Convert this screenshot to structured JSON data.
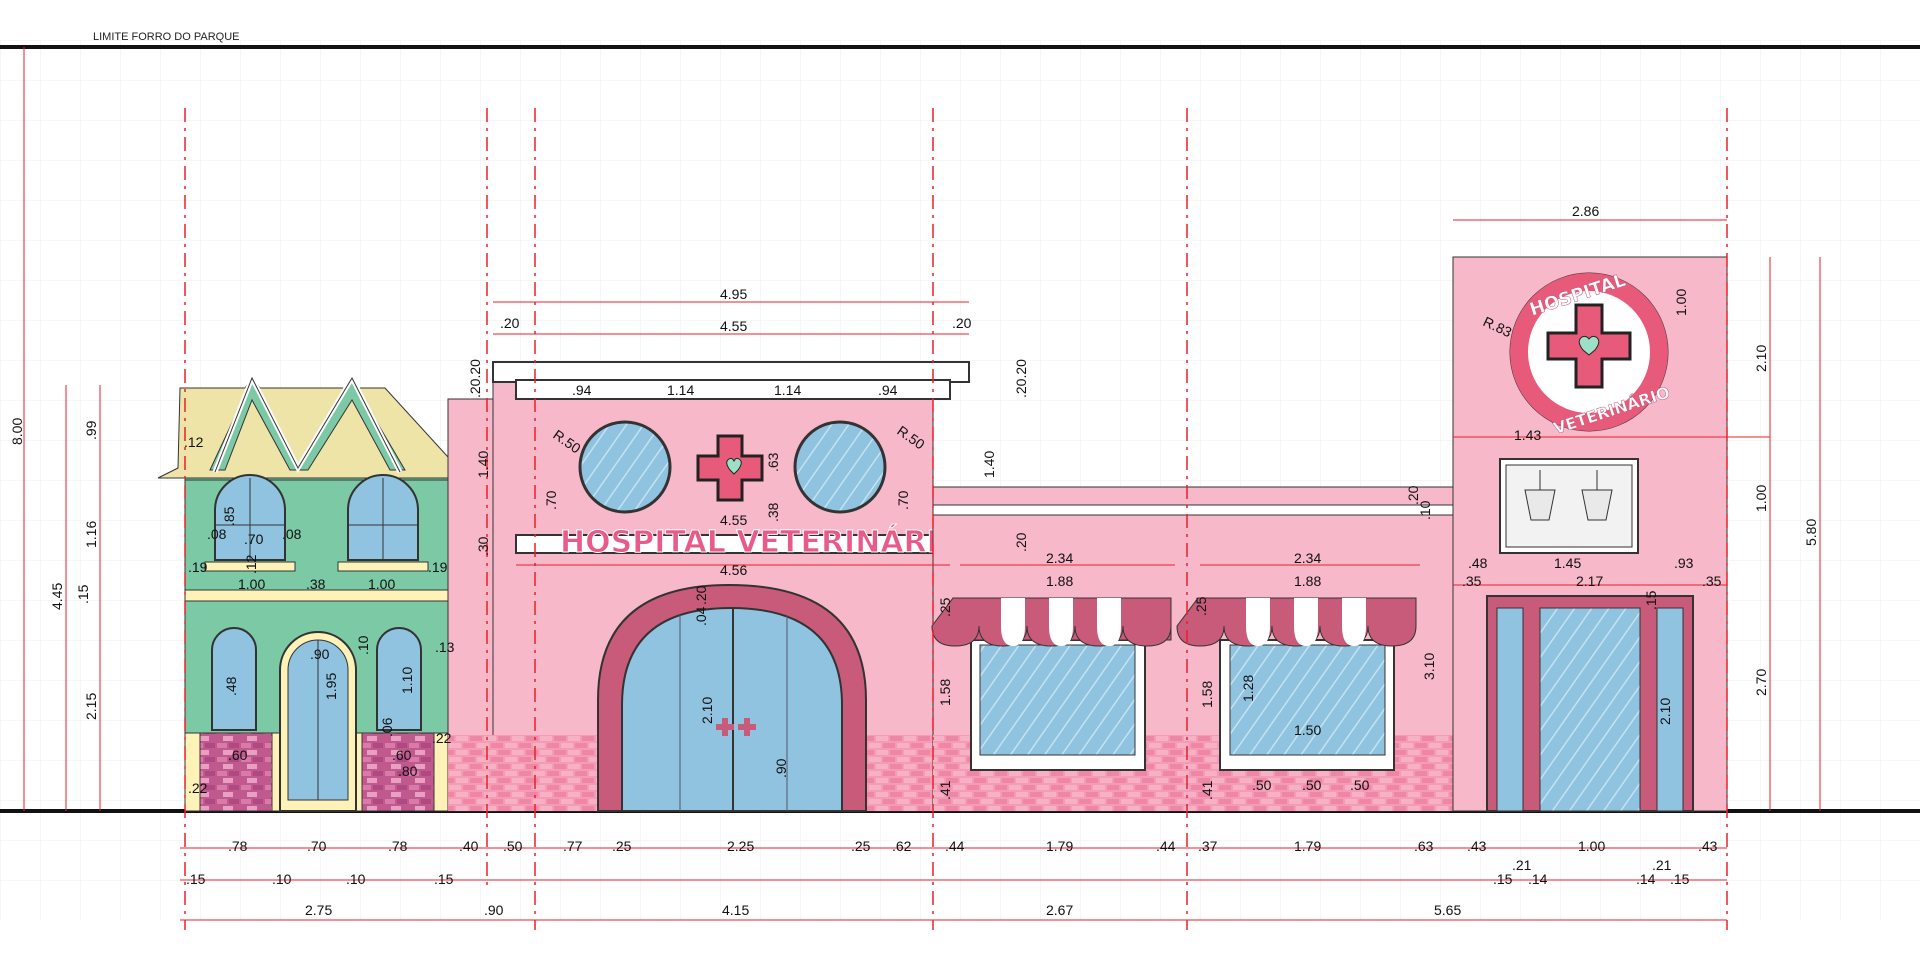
{
  "drawing": {
    "ceiling_label": "LIMITE FORRO DO PARQUE",
    "sign_text": "HOSPITAL VETERINÁRIO",
    "badge_top": "HOSPITAL",
    "badge_bottom": "VETERINÁRIO",
    "colors": {
      "dimension": "#e8202a",
      "pink_wall": "#f7b8c9",
      "dark_pink": "#c85a7a",
      "green_house": "#7cc9a6",
      "roof": "#efe4a8",
      "glass": "#8fc3e0",
      "brick": "#f08aa8"
    }
  },
  "dimensions": {
    "total_height": "8.00",
    "house_height": "4.45",
    "house_roof": ".99",
    "house_upper": "1.16",
    "house_band": ".15",
    "house_lower": "2.15",
    "eave": ".12",
    "house_w1": ".19",
    "house_w2": "1.00",
    "house_w3": ".38",
    "house_w4": "1.00",
    "house_w5": ".19",
    "upper_win_w": ".70",
    "upper_win_side_l": ".08",
    "upper_win_side_r": ".08",
    "upper_win_arch": ".85",
    "upper_win_sill": ".12",
    "door_w": ".90",
    "door_h": "1.95",
    "door_top": ".10",
    "small_win_h": ".48",
    "small_win_h2": "1.10",
    "small_win_top": ".06",
    "small_win_side": ".13",
    "planter_w1": ".60",
    "planter_w2": ".60",
    "planter_h": ".80",
    "planter_gap": ".22",
    "base_l": ".22",
    "hospital_top": "4.95",
    "hospital_inner": "4.55",
    "cornice_l": ".20",
    "cornice_r": ".20",
    "cornice_h_l": ".20.20",
    "cornice_h_r": ".20.20",
    "porthole_r_l": "R.50",
    "porthole_r_r": "R.50",
    "porthole_h_l": ".70",
    "porthole_h_r": ".70",
    "wall_upper_l": "1.40",
    "wall_upper_r": "1.40",
    "cross_h": ".63",
    "cross_sub": ".38",
    "seg_94a": ".94",
    "seg_114a": "1.14",
    "seg_114b": "1.14",
    "seg_94b": ".94",
    "sign_w": "4.55",
    "band_w": "4.56",
    "band_h_l": ".30",
    "band_h_r": ".20",
    "arch_top": ".20",
    "arch_ins": ".04",
    "arch_door_h": "2.10",
    "arch_handle": ".90",
    "side_h": ".25",
    "shop_top1": "2.34",
    "shop_top2": "2.34",
    "shop_in1": "1.88",
    "shop_in2": "1.88",
    "shop_h1": "1.58",
    "shop_h2": "1.58",
    "shop_win_h": "1.28",
    "shop_win_w": "1.50",
    "shop_sub1": ".50",
    "shop_sub2": ".50",
    "shop_sub3": ".50",
    "shop_base1": ".41",
    "shop_base2": ".41",
    "shop_side": ".25",
    "mid_cornice1": ".20",
    "mid_cornice2": ".10",
    "mid_wall": "3.10",
    "tower_w": "2.86",
    "tower_badge_r": "R.83",
    "tower_badge_h": "1.00",
    "tower_top": "2.10",
    "tower_mid": "1.00",
    "tower_low": "2.70",
    "tower_total": "5.80",
    "lamp_w": "1.43",
    "tower_a": ".48",
    "tower_b": "1.45",
    "tower_c": ".93",
    "tower_d": ".35",
    "tower_e": "2.17",
    "tower_f": ".35",
    "tower_door_top": ".15",
    "tower_door_h": "2.10",
    "b_78a": ".78",
    "b_70": ".70",
    "b_78b": ".78",
    "b_40": ".40",
    "b_50": ".50",
    "b_77": ".77",
    "b_25a": ".25",
    "b_225": "2.25",
    "b_25b": ".25",
    "b_62": ".62",
    "b_44a": ".44",
    "b_179a": "1.79",
    "b_44b": ".44",
    "b_37": ".37",
    "b_179b": "1.79",
    "b_63": ".63",
    "b_43a": ".43",
    "b_100": "1.00",
    "b_43b": ".43",
    "b2_15a": ".15",
    "b2_10a": ".10",
    "b2_10b": ".10",
    "b2_15b": ".15",
    "b2_15c": ".15",
    "b2_21a": ".21",
    "b2_14a": ".14",
    "b2_14b": ".14",
    "b2_21b": ".21",
    "b2_15d": ".15",
    "t_275": "2.75",
    "t_90": ".90",
    "t_415": "4.15",
    "t_267": "2.67",
    "t_565": "5.65"
  }
}
